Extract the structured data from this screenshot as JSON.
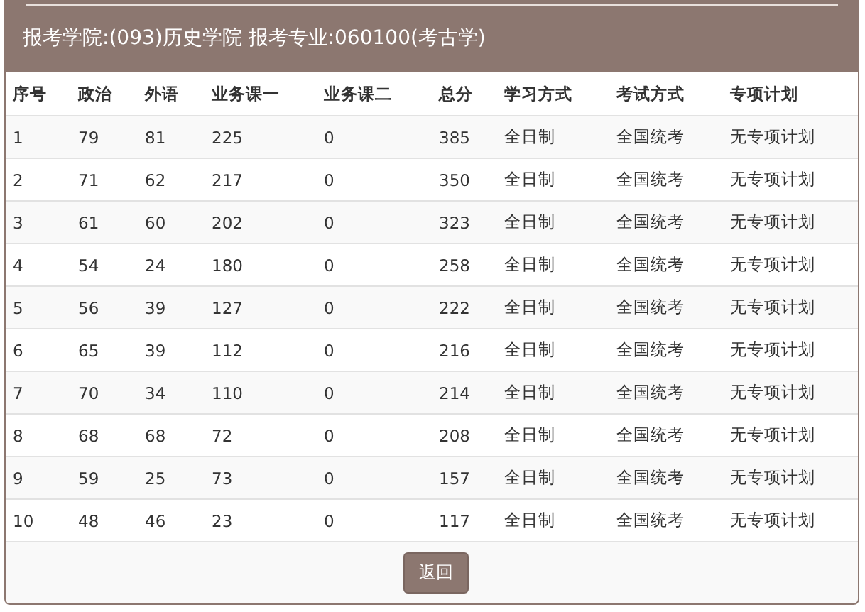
{
  "heading": "报考学院:(093)历史学院 报考专业:060100(考古学)",
  "table": {
    "columns": [
      "序号",
      "政治",
      "外语",
      "业务课一",
      "业务课二",
      "总分",
      "学习方式",
      "考试方式",
      "专项计划"
    ],
    "rows": [
      [
        "1",
        "79",
        "81",
        "225",
        "0",
        "385",
        "全日制",
        "全国统考",
        "无专项计划"
      ],
      [
        "2",
        "71",
        "62",
        "217",
        "0",
        "350",
        "全日制",
        "全国统考",
        "无专项计划"
      ],
      [
        "3",
        "61",
        "60",
        "202",
        "0",
        "323",
        "全日制",
        "全国统考",
        "无专项计划"
      ],
      [
        "4",
        "54",
        "24",
        "180",
        "0",
        "258",
        "全日制",
        "全国统考",
        "无专项计划"
      ],
      [
        "5",
        "56",
        "39",
        "127",
        "0",
        "222",
        "全日制",
        "全国统考",
        "无专项计划"
      ],
      [
        "6",
        "65",
        "39",
        "112",
        "0",
        "216",
        "全日制",
        "全国统考",
        "无专项计划"
      ],
      [
        "7",
        "70",
        "34",
        "110",
        "0",
        "214",
        "全日制",
        "全国统考",
        "无专项计划"
      ],
      [
        "8",
        "68",
        "68",
        "72",
        "0",
        "208",
        "全日制",
        "全国统考",
        "无专项计划"
      ],
      [
        "9",
        "59",
        "25",
        "73",
        "0",
        "157",
        "全日制",
        "全国统考",
        "无专项计划"
      ],
      [
        "10",
        "48",
        "46",
        "23",
        "0",
        "117",
        "全日制",
        "全国统考",
        "无专项计划"
      ]
    ]
  },
  "buttons": [
    "返回"
  ]
}
